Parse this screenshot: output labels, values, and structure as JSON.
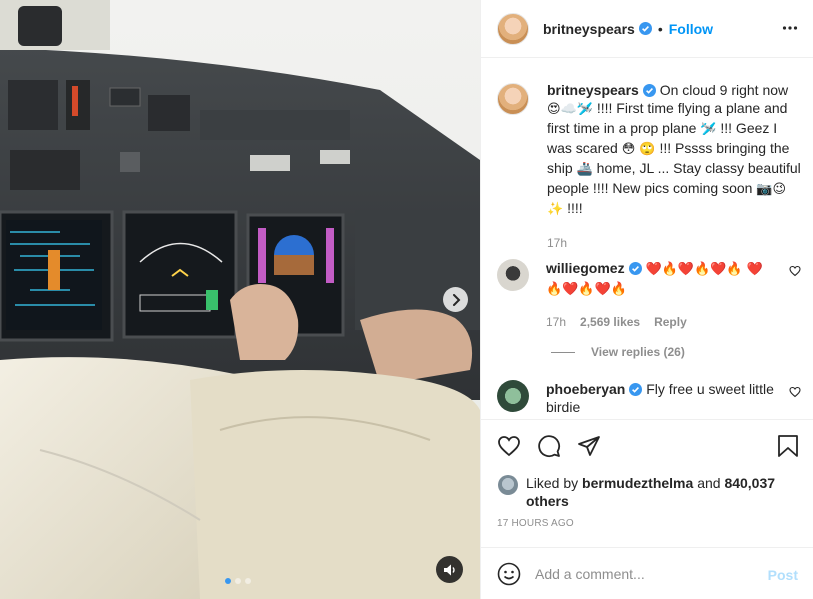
{
  "post": {
    "author": "britneyspears",
    "follow_label": "Follow",
    "separator": "•",
    "caption_emoji_1": "😍☁️🛩️",
    "caption_text_1": " !!!! First time flying a plane and first time in a prop plane ",
    "caption_emoji_2": "🛩️",
    "caption_text_2": " !!! Geez I was scared ",
    "caption_emoji_3": "😳 🙄",
    "caption_text_3": " !!! Pssss bringing the ship ",
    "caption_emoji_4": "🚢",
    "caption_text_4": " home, JL ... Stay classy beautiful people !!!! New pics coming soon ",
    "caption_emoji_5": "📷😉 ✨",
    "caption_text_5": " !!!!",
    "caption_lead": "On cloud 9 right now",
    "caption_time": "17h"
  },
  "comments": [
    {
      "user": "williegomez",
      "text": "❤️🔥❤️🔥❤️🔥 ❤️🔥❤️🔥❤️🔥",
      "time": "17h",
      "likes": "2,569 likes",
      "reply_label": "Reply",
      "view_replies": "View replies (26)"
    },
    {
      "user": "phoeberyan",
      "text": "Fly free u sweet little birdie"
    }
  ],
  "likes": {
    "prefix": "Liked by",
    "user": "bermudezthelma",
    "and": "and",
    "count": "840,037 others"
  },
  "date": "17 HOURS AGO",
  "add_comment": {
    "placeholder": "Add a comment...",
    "post_label": "Post"
  },
  "icons": {
    "verified": "verified-badge-icon",
    "more": "more-options-icon",
    "like": "heart-icon",
    "comment": "comment-bubble-icon",
    "share": "paper-plane-icon",
    "save": "bookmark-icon",
    "emoji": "smiley-icon",
    "next": "chevron-right-icon",
    "sound": "speaker-icon"
  },
  "colors": {
    "accent": "#0095f6",
    "post_disabled": "#b2dffc",
    "muted": "#8e8e8e"
  },
  "carousel": {
    "count": 3,
    "active": 1
  }
}
